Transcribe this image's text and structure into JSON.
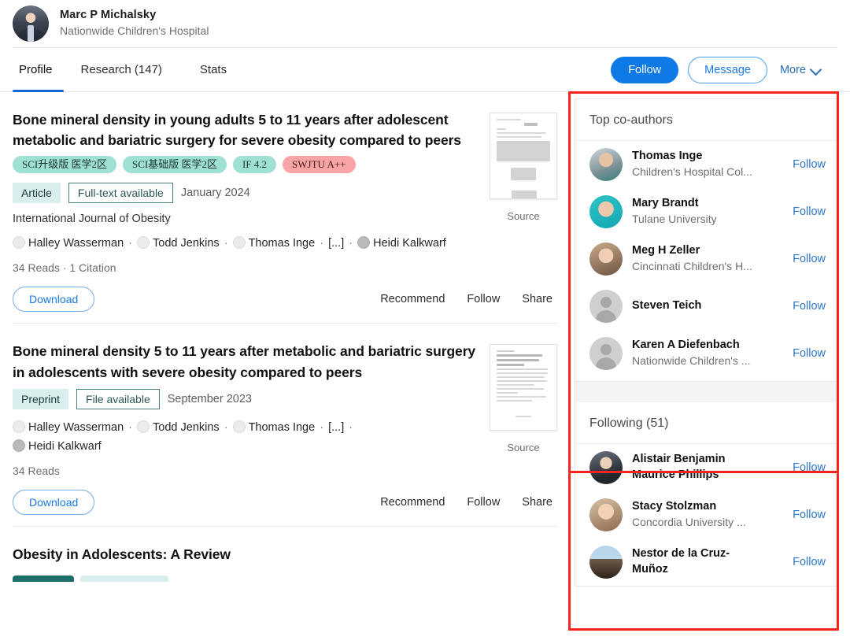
{
  "header": {
    "name": "Marc P Michalsky",
    "affiliation": "Nationwide Children's Hospital",
    "avatar_icon": "user-photo-avatar"
  },
  "tabs": [
    {
      "label": "Profile",
      "active": true
    },
    {
      "label": "Research (147)",
      "active": false
    },
    {
      "label": "Stats",
      "active": false
    }
  ],
  "header_actions": {
    "follow_label": "Follow",
    "message_label": "Message",
    "more_label": "More",
    "more_icon": "chevron-down-icon",
    "follow_color": "#0d7ae5",
    "message_border_color": "#4a9bec"
  },
  "publications": [
    {
      "title": "Bone mineral density in young adults 5 to 11 years after adolescent metabolic and bariatric surgery for severe obesity compared to peers",
      "badges": [
        {
          "text": "SCI升级版 医学2区",
          "color": "teal"
        },
        {
          "text": "SCI基础版 医学2区",
          "color": "teal"
        },
        {
          "text": "IF 4.2",
          "color": "teal"
        },
        {
          "text": "SWJTU A++",
          "color": "pink"
        }
      ],
      "type_chip": "Article",
      "availability_chip": "Full-text available",
      "date": "January 2024",
      "journal": "International Journal of Obesity",
      "authors": [
        "Halley Wasserman",
        "Todd Jenkins",
        "Thomas Inge",
        "[...]",
        "Heidi Kalkwarf"
      ],
      "stats": "34 Reads · 1 Citation",
      "download_label": "Download",
      "action_links": [
        "Recommend",
        "Follow",
        "Share"
      ],
      "thumb_caption": "Source"
    },
    {
      "title": "Bone mineral density 5 to 11 years after metabolic and bariatric surgery in adolescents with severe obesity compared to peers",
      "badges": [],
      "type_chip": "Preprint",
      "availability_chip": "File available",
      "date": "September 2023",
      "journal": "",
      "authors": [
        "Halley Wasserman",
        "Todd Jenkins",
        "Thomas Inge",
        "[...]",
        "Heidi Kalkwarf"
      ],
      "stats": "34 Reads",
      "download_label": "Download",
      "action_links": [
        "Recommend",
        "Follow",
        "Share"
      ],
      "thumb_caption": "Source"
    },
    {
      "title": "Obesity in Adolescents: A Review",
      "badges": [],
      "type_chip": "",
      "availability_chip": "",
      "date": "",
      "journal": "",
      "authors": [],
      "stats": "",
      "download_label": "",
      "action_links": [],
      "thumb_caption": ""
    }
  ],
  "sidebar": {
    "coauthors": {
      "title": "Top co-authors",
      "people": [
        {
          "name": "Thomas Inge",
          "affiliation": "Children's Hospital Col...",
          "follow_label": "Follow",
          "avatar": "photo"
        },
        {
          "name": "Mary Brandt",
          "affiliation": "Tulane University",
          "follow_label": "Follow",
          "avatar": "photo"
        },
        {
          "name": "Meg H Zeller",
          "affiliation": "Cincinnati Children's H...",
          "follow_label": "Follow",
          "avatar": "photo"
        },
        {
          "name": "Steven Teich",
          "affiliation": "",
          "follow_label": "Follow",
          "avatar": "placeholder"
        },
        {
          "name": "Karen A Diefenbach",
          "affiliation": "Nationwide Children's ...",
          "follow_label": "Follow",
          "avatar": "placeholder"
        }
      ]
    },
    "following": {
      "title": "Following (51)",
      "people": [
        {
          "name": "Alistair Benjamin Maurice Phillips",
          "affiliation": "",
          "follow_label": "Follow",
          "avatar": "photo"
        },
        {
          "name": "Stacy Stolzman",
          "affiliation": "Concordia University ...",
          "follow_label": "Follow",
          "avatar": "photo"
        },
        {
          "name": "Nestor de la Cruz-Muñoz",
          "affiliation": "",
          "follow_label": "Follow",
          "avatar": "photo"
        }
      ]
    },
    "highlight_color": "#f5241f"
  }
}
